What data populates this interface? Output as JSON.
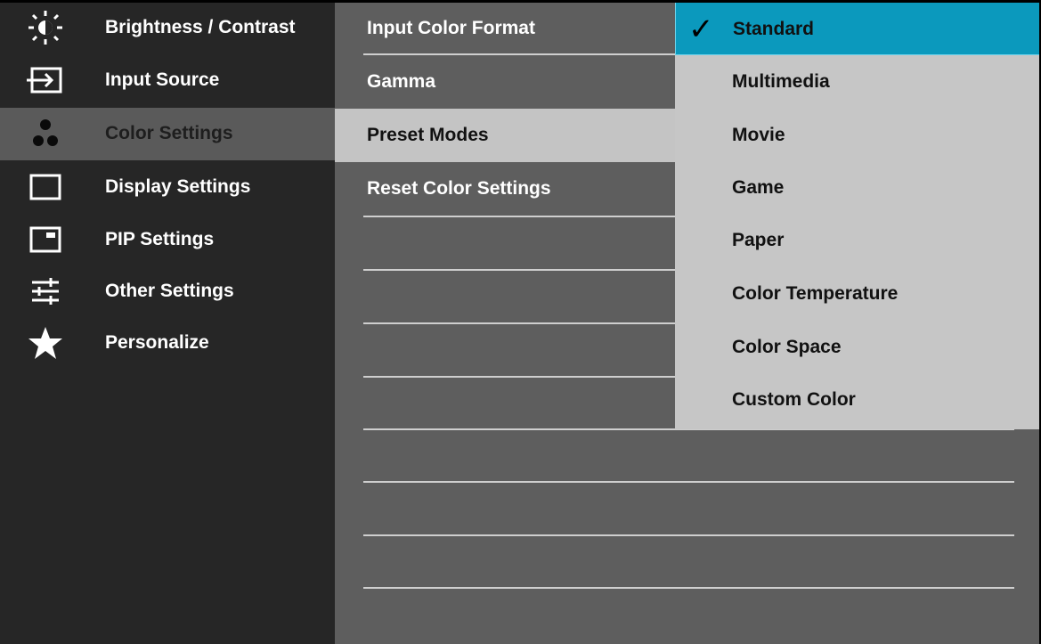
{
  "main_menu": [
    {
      "label": "Brightness / Contrast",
      "icon": "brightness-icon"
    },
    {
      "label": "Input Source",
      "icon": "input-source-icon"
    },
    {
      "label": "Color Settings",
      "icon": "color-dots-icon",
      "selected": true
    },
    {
      "label": "Display Settings",
      "icon": "display-icon"
    },
    {
      "label": "PIP Settings",
      "icon": "pip-icon"
    },
    {
      "label": "Other Settings",
      "icon": "sliders-icon"
    },
    {
      "label": "Personalize",
      "icon": "star-icon"
    }
  ],
  "sub_menu": [
    {
      "label": "Input Color Format"
    },
    {
      "label": "Gamma"
    },
    {
      "label": "Preset Modes",
      "selected": true
    },
    {
      "label": "Reset Color Settings"
    }
  ],
  "options": [
    {
      "label": "Standard",
      "selected": true
    },
    {
      "label": "Multimedia"
    },
    {
      "label": "Movie"
    },
    {
      "label": "Game"
    },
    {
      "label": "Paper"
    },
    {
      "label": "Color Temperature"
    },
    {
      "label": "Color Space"
    },
    {
      "label": "Custom Color"
    }
  ],
  "colors": {
    "highlight": "#0b99bd",
    "panel": "#5e5e5e",
    "sidebar": "#262626",
    "options_bg": "#c6c6c6"
  }
}
